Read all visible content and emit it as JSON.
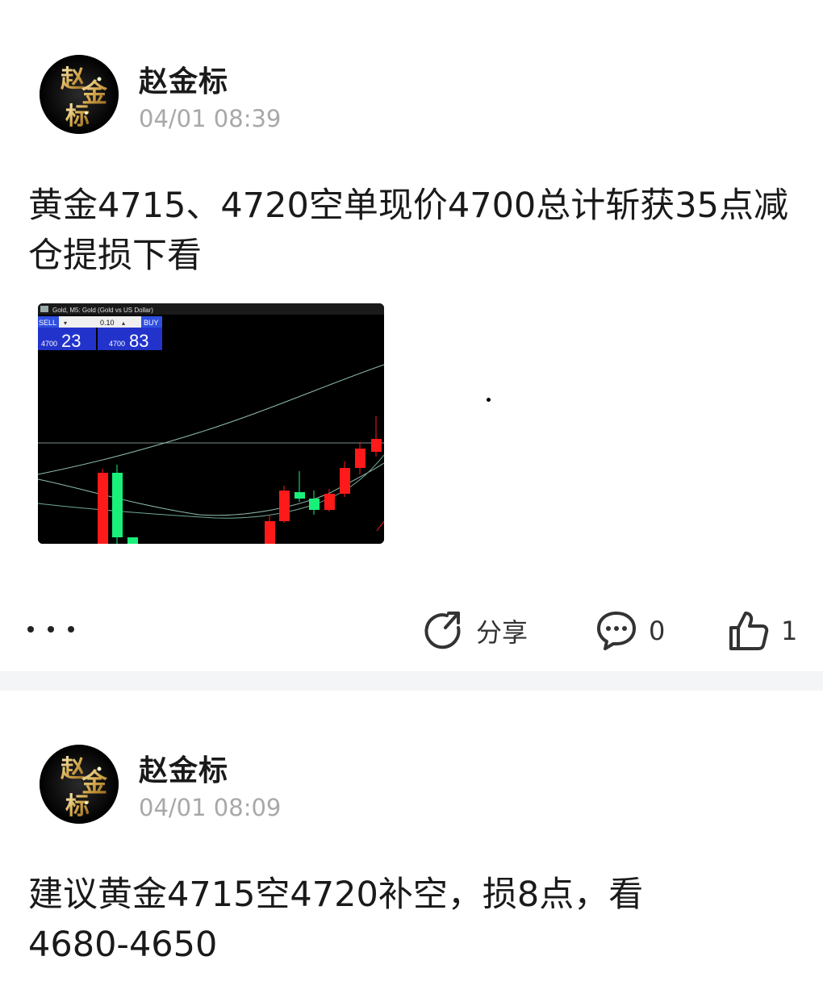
{
  "posts": [
    {
      "author": "赵金标",
      "time": "04/01 08:39",
      "content": "黄金4715、4720空单现价4700总计斩获35点减仓提损下看",
      "chart": {
        "window_title": "Gold, M5:  Gold (Gold vs US Dollar)",
        "sell_label": "SELL",
        "buy_label": "BUY",
        "lot": "0.10",
        "sell_price_prefix": "4700",
        "sell_price_big": "23",
        "buy_price_prefix": "4700",
        "buy_price_big": "83"
      },
      "actions": {
        "share_label": "分享",
        "comment_count": "0",
        "like_count": "1"
      }
    },
    {
      "author": "赵金标",
      "time": "04/01 08:09",
      "content": "建议黄金4715空4720补空，损8点，看4680-4650"
    }
  ],
  "avatar_text": "赵金标",
  "colors": {
    "accent_gold": "#d4a84a",
    "bull_candle": "#ff1a1a",
    "bear_candle": "#19f07a",
    "time_gray": "#a8a8a8"
  },
  "icons": [
    "more-icon",
    "share-icon",
    "comment-icon",
    "like-icon"
  ]
}
